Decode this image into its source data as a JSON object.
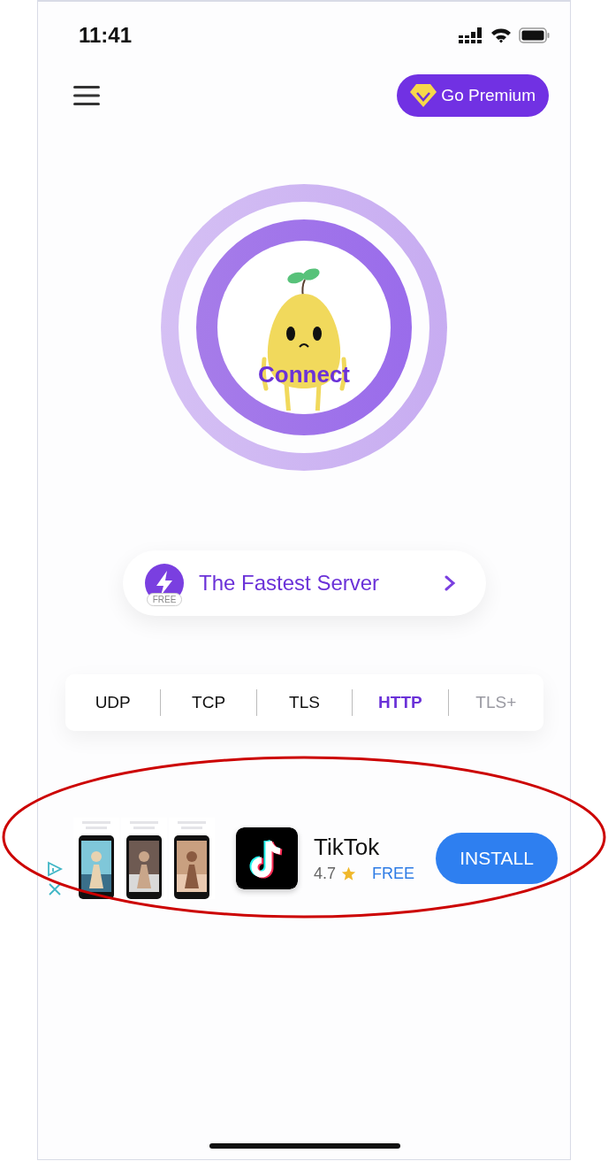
{
  "status_bar": {
    "time": "11:41"
  },
  "premium_button": {
    "label": "Go Premium"
  },
  "connect_button": {
    "label": "Connect"
  },
  "server": {
    "label": "The Fastest Server",
    "badge": "FREE"
  },
  "protocols": [
    {
      "label": "UDP",
      "selected": false,
      "faded": false
    },
    {
      "label": "TCP",
      "selected": false,
      "faded": false
    },
    {
      "label": "TLS",
      "selected": false,
      "faded": false
    },
    {
      "label": "HTTP",
      "selected": true,
      "faded": false
    },
    {
      "label": "TLS+",
      "selected": false,
      "faded": true
    }
  ],
  "ad": {
    "app_name": "TikTok",
    "rating": "4.7",
    "price": "FREE",
    "install": "INSTALL"
  }
}
